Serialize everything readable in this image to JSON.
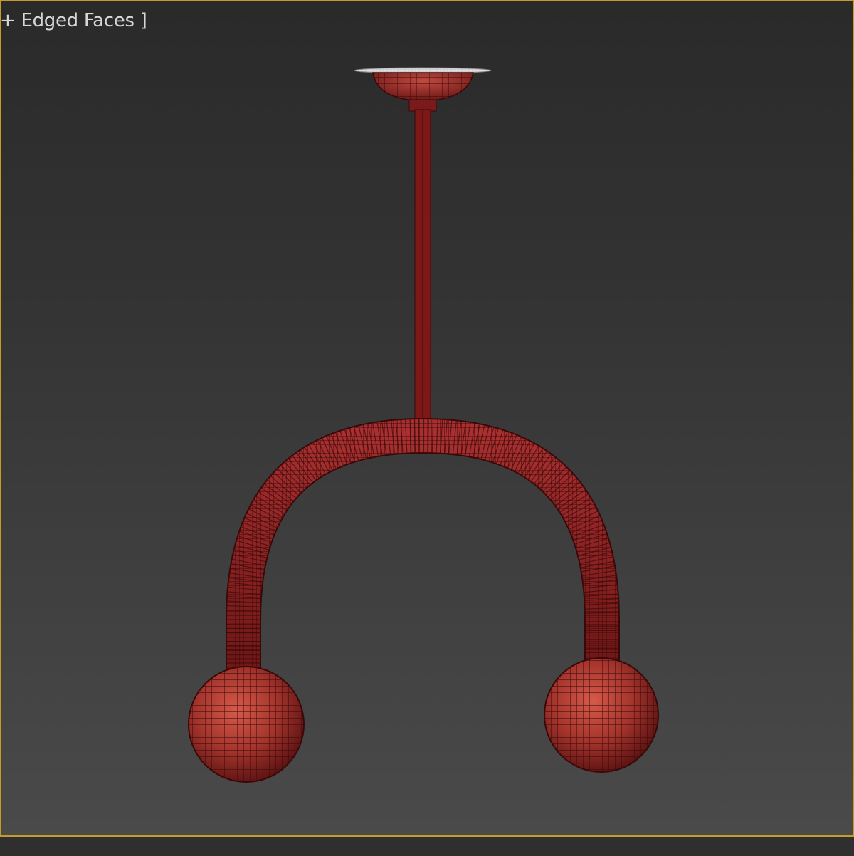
{
  "viewport": {
    "shading_label": "+ Edged Faces ]",
    "active_border_color": "#c79a2c",
    "object_color": "#8a1d1d"
  }
}
